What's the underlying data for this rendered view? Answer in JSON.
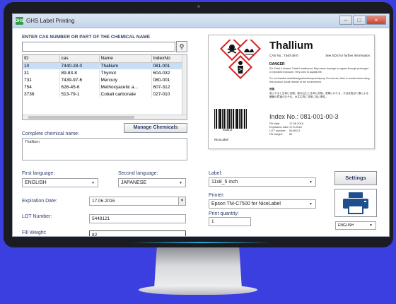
{
  "window": {
    "title": "GHS Label Printing",
    "icon_text": "GHS",
    "controls": {
      "minimize": "–",
      "maximize": "□",
      "close": "×"
    }
  },
  "search": {
    "label": "ENTER CAS NUMBER OR PART OF THE CHEMICAL NAME",
    "value": "",
    "button_icon": "search-icon"
  },
  "table": {
    "columns": [
      "ID",
      "cas",
      "Name",
      "IndexNo"
    ],
    "rows": [
      [
        "10",
        "7440-28-0",
        "Thallium",
        "081-001"
      ],
      [
        "31",
        "89-83-8",
        "Thymol",
        "604-032"
      ],
      [
        "731",
        "7439-97-6",
        "Mercury",
        "080-001"
      ],
      [
        "754",
        "626-45-6",
        "Methoxyacetic a...",
        "607-312"
      ],
      [
        "3736",
        "513-79-1",
        "Cobalt carbonate",
        "027-010"
      ]
    ],
    "selected_row": 0
  },
  "manage_button": "Manage Chemicals",
  "complete_name": {
    "label": "Complete chemical name:",
    "value": "Thallium"
  },
  "languages": {
    "first_label": "First language:",
    "first_value": "ENGLISH",
    "second_label": "Second language:",
    "second_value": "JAPANESE"
  },
  "expiration": {
    "label": "Expiration Date:",
    "value": "17.06.2016"
  },
  "lot": {
    "label": "LOT Number:",
    "value": "5448121"
  },
  "fill": {
    "label": "Fill Weight:",
    "value": "82"
  },
  "label_select": {
    "label": "Label:",
    "value": "11x8_5 inch"
  },
  "printer": {
    "label": "Printer:",
    "value": "Epson TM-C7500 for NiceLabel"
  },
  "quantity": {
    "label": "Print quantity:",
    "value": "1"
  },
  "settings_button": "Settings",
  "preview_language": "ENGLISH",
  "preview": {
    "name": "Thallium",
    "cas_line": "CAS No.: 7440-28-0",
    "sds_note": "See SDS for further information",
    "signal_word": "DANGER",
    "hazard_en": "EH: Fatal if inhaled. Fatal if swallowed. May cause damage to organs through prolonged or repeated exposure. Very toxic to aquatic life.",
    "precaution_en": "Do not breathe dust/fume/gas/mist/vapours/spray. Do not eat, drink or smoke when using this product. Avoid release to the environment.",
    "signal_word_jp": "危険",
    "hazard_jp": "吸入すると生命に危険。飲み込むと生命に危険。長期にわたる、又は反復ばく露による臓器の障害のおそれ。水生生物に非常に強い毒性。",
    "index_line": "Index No.:  081-001-00-3",
    "barcode_number": "5448121",
    "brand": "NiceLabel",
    "meta_keys": [
      "Fill date:",
      "Expiration date:",
      "LOT number:",
      "Fill weight:"
    ],
    "meta_values": [
      "17.06.2016",
      "17.6.2016",
      "5448121",
      "82"
    ]
  },
  "colors": {
    "accent": "#2c3e6a",
    "background": "#3b3fe0",
    "selection": "#c7def6",
    "printer_icon": "#1f4f8c"
  }
}
